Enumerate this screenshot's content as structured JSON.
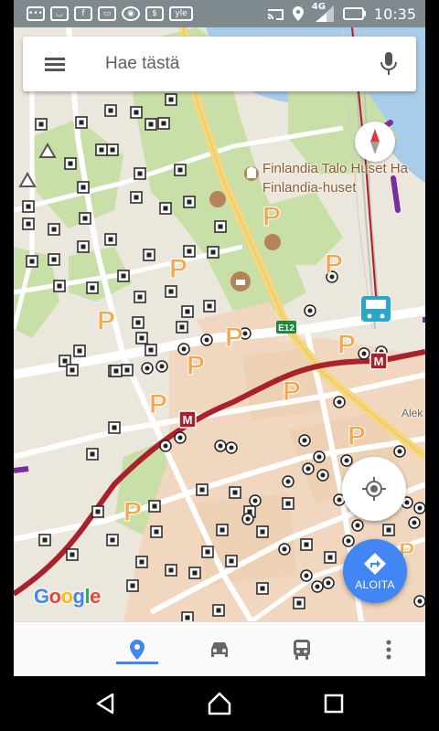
{
  "status_bar": {
    "network": "4G",
    "time": "10:35",
    "apps": [
      "message-icon",
      "shield-icon",
      "facebook-icon",
      "gallery-icon",
      "app-icon",
      "pay-icon",
      "yle-icon"
    ],
    "yle_label": "yle",
    "facebook_label": "f"
  },
  "search": {
    "placeholder": "Hae tästä"
  },
  "map": {
    "labels": {
      "finlandia_talo": "Finlandia Talo Huset Ha",
      "finlandia_huset": "Finlandia-huset",
      "road_e12": "E12",
      "alek": "Alek"
    },
    "metro_symbol": "M",
    "parking_symbol": "P",
    "colors": {
      "land": "#ece7dd",
      "park": "#c8dfa8",
      "water": "#a8cdea",
      "road": "#ffffff",
      "highway": "#f6d77c",
      "rail": "#a9212a",
      "urban": "#f1d7bf",
      "parking": "#f6a54a",
      "accent": "#4285f4"
    }
  },
  "buttons": {
    "go_label": "ALOITA"
  },
  "google_logo": {
    "letters": [
      "G",
      "o",
      "o",
      "g",
      "l",
      "e"
    ],
    "colors": [
      "#4285f4",
      "#ea4335",
      "#fbbc05",
      "#4285f4",
      "#34a853",
      "#ea4335"
    ]
  },
  "bottom_nav": {
    "tabs": [
      "explore-icon",
      "car-icon",
      "transit-icon",
      "more-icon"
    ],
    "active": "explore-icon"
  }
}
